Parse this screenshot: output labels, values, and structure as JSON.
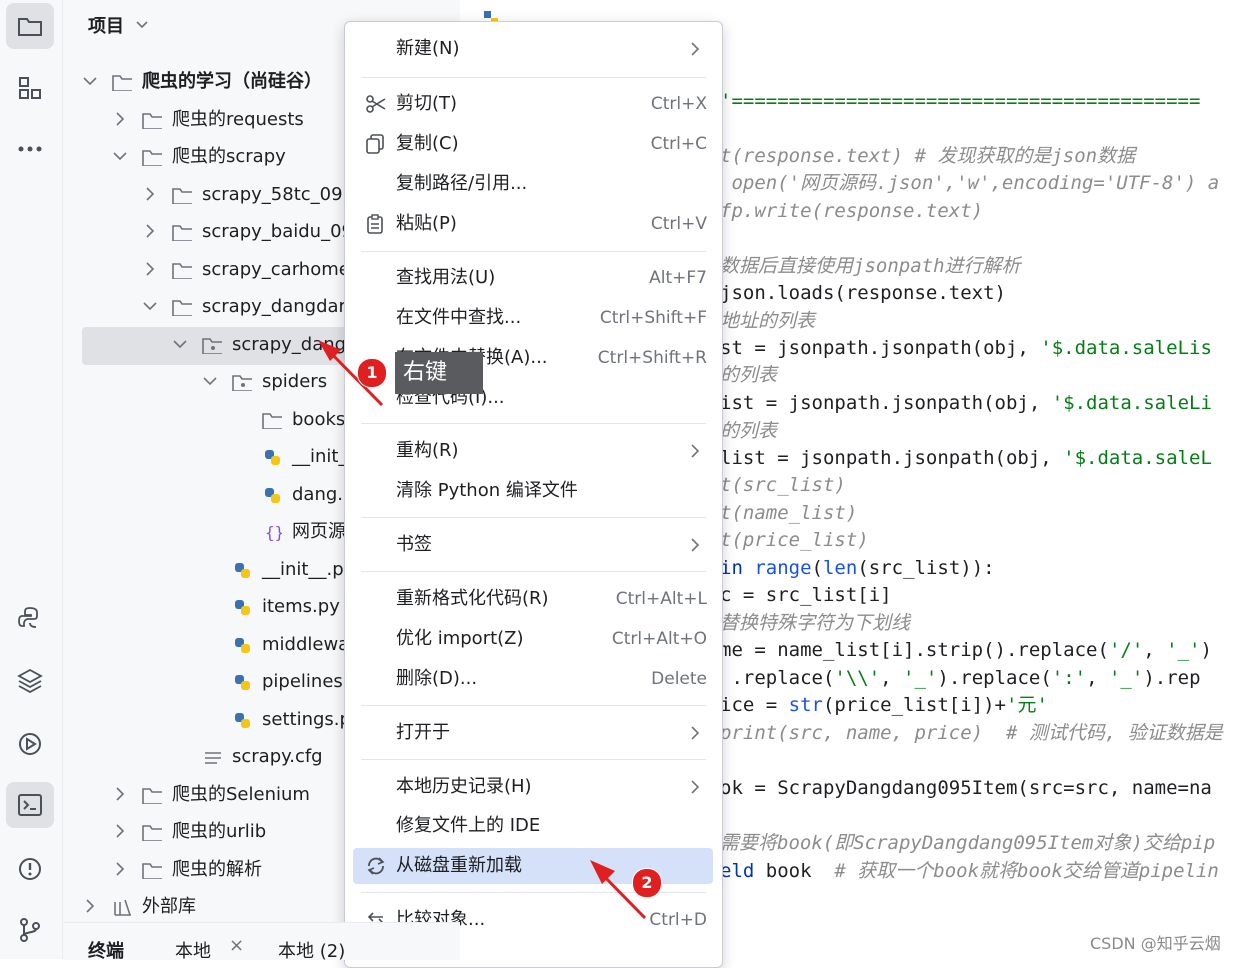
{
  "project_panel": {
    "title": "项目",
    "tree": [
      {
        "label": "爬虫的学习（尚硅谷）",
        "kind": "folder",
        "expanded": true
      },
      {
        "label": "爬虫的requests",
        "kind": "folder",
        "expanded": false
      },
      {
        "label": "爬虫的scrapy",
        "kind": "folder",
        "expanded": true
      },
      {
        "label": "scrapy_58tc_09",
        "kind": "folder",
        "expanded": false
      },
      {
        "label": "scrapy_baidu_09",
        "kind": "folder",
        "expanded": false
      },
      {
        "label": "scrapy_carhome",
        "kind": "folder",
        "expanded": false
      },
      {
        "label": "scrapy_dangdar",
        "kind": "folder",
        "expanded": true
      },
      {
        "label": "scrapy_dang",
        "kind": "package",
        "expanded": true
      },
      {
        "label": "spiders",
        "kind": "package",
        "expanded": true
      },
      {
        "label": "books",
        "kind": "folder"
      },
      {
        "label": "__init_",
        "kind": "python"
      },
      {
        "label": "dang.",
        "kind": "python"
      },
      {
        "label": "网页源",
        "kind": "json"
      },
      {
        "label": "__init__.py",
        "kind": "python"
      },
      {
        "label": "items.py",
        "kind": "python"
      },
      {
        "label": "middlewa",
        "kind": "python"
      },
      {
        "label": "pipelines.",
        "kind": "python"
      },
      {
        "label": "settings.p",
        "kind": "python"
      },
      {
        "label": "scrapy.cfg",
        "kind": "config"
      },
      {
        "label": "爬虫的Selenium",
        "kind": "folder",
        "expanded": false
      },
      {
        "label": "爬虫的urlib",
        "kind": "folder",
        "expanded": false
      },
      {
        "label": "爬虫的解析",
        "kind": "folder",
        "expanded": false
      },
      {
        "label": "外部库",
        "kind": "library",
        "expanded": false
      }
    ]
  },
  "bottom_tabs": {
    "terminal": "终端",
    "tab1": "本地",
    "tab2": "本地 (2)"
  },
  "context_menu": {
    "items": [
      {
        "label": "新建(N)",
        "submenu": true
      },
      {
        "label": "剪切(T)",
        "shortcut": "Ctrl+X",
        "icon": "scissors-icon"
      },
      {
        "label": "复制(C)",
        "shortcut": "Ctrl+C",
        "icon": "copy-icon"
      },
      {
        "label": "复制路径/引用..."
      },
      {
        "label": "粘贴(P)",
        "shortcut": "Ctrl+V",
        "icon": "paste-icon"
      },
      {
        "label": "查找用法(U)",
        "shortcut": "Alt+F7"
      },
      {
        "label": "在文件中查找...",
        "shortcut": "Ctrl+Shift+F"
      },
      {
        "label": "在文件中替换(A)...",
        "shortcut": "Ctrl+Shift+R"
      },
      {
        "label": "检查代码(I)..."
      },
      {
        "label": "重构(R)",
        "submenu": true
      },
      {
        "label": "清除 Python 编译文件"
      },
      {
        "label": "书签",
        "submenu": true
      },
      {
        "label": "重新格式化代码(R)",
        "shortcut": "Ctrl+Alt+L"
      },
      {
        "label": "优化 import(Z)",
        "shortcut": "Ctrl+Alt+O"
      },
      {
        "label": "删除(D)...",
        "shortcut": "Delete"
      },
      {
        "label": "打开于",
        "submenu": true
      },
      {
        "label": "本地历史记录(H)",
        "submenu": true
      },
      {
        "label": "修复文件上的 IDE"
      },
      {
        "label": "从磁盘重新加载",
        "icon": "reload-icon",
        "highlighted": true
      },
      {
        "label": "比较对象...",
        "shortcut": "Ctrl+D",
        "icon": "compare-icon"
      }
    ]
  },
  "annotations": {
    "badge1": "1",
    "right_click_label": "右键",
    "badge2": "2"
  },
  "code_lines": [
    {
      "parts": [
        [
          "str",
          "'========================================="
        ]
      ]
    },
    {
      "parts": [
        [
          "cm",
          "t(response.text) # 发现获取的是json数据"
        ]
      ]
    },
    {
      "parts": [
        [
          "cm",
          " open('网页源码.json','w',encoding='UTF-8') a"
        ]
      ]
    },
    {
      "parts": [
        [
          "cm",
          "fp.write(response.text)"
        ]
      ]
    },
    {
      "parts": [
        [
          "cm",
          "数据后直接使用jsonpath进行解析"
        ]
      ]
    },
    {
      "parts": [
        [
          "",
          "json.loads(response.text)"
        ]
      ]
    },
    {
      "parts": [
        [
          "cm",
          "地址的列表"
        ]
      ]
    },
    {
      "parts": [
        [
          "",
          "st = jsonpath.jsonpath(obj, "
        ],
        [
          "str",
          "'$.data.saleLis"
        ]
      ]
    },
    {
      "parts": [
        [
          "cm",
          "的列表"
        ]
      ]
    },
    {
      "parts": [
        [
          "",
          "ist = jsonpath.jsonpath(obj, "
        ],
        [
          "str",
          "'$.data.saleLi"
        ]
      ]
    },
    {
      "parts": [
        [
          "cm",
          "的列表"
        ]
      ]
    },
    {
      "parts": [
        [
          "",
          "list = jsonpath.jsonpath(obj, "
        ],
        [
          "str",
          "'$.data.saleL"
        ]
      ]
    },
    {
      "parts": [
        [
          "cm",
          "t(src_list)"
        ]
      ]
    },
    {
      "parts": [
        [
          "cm",
          "t(name_list)"
        ]
      ]
    },
    {
      "parts": [
        [
          "cm",
          "t(price_list)"
        ]
      ]
    },
    {
      "parts": [
        [
          "kw",
          "in "
        ],
        [
          "fn",
          "range"
        ],
        [
          "",
          "("
        ],
        [
          "fn",
          "len"
        ],
        [
          "",
          "(src_list)):"
        ]
      ]
    },
    {
      "parts": [
        [
          "",
          "c = src_list[i]"
        ]
      ]
    },
    {
      "parts": [
        [
          "cm",
          "替换特殊字符为下划线"
        ]
      ]
    },
    {
      "parts": [
        [
          "",
          "me = name_list[i].strip().replace("
        ],
        [
          "str",
          "'/'"
        ],
        [
          "",
          ", "
        ],
        [
          "str",
          "'_'"
        ],
        [
          "",
          ")"
        ]
      ]
    },
    {
      "parts": [
        [
          "",
          " .replace("
        ],
        [
          "str",
          "'\\\\'"
        ],
        [
          "",
          ", "
        ],
        [
          "str",
          "'_'"
        ],
        [
          "",
          ").replace("
        ],
        [
          "str",
          "':'"
        ],
        [
          "",
          ", "
        ],
        [
          "str",
          "'_'"
        ],
        [
          "",
          ").rep"
        ]
      ]
    },
    {
      "parts": [
        [
          "",
          "ice = "
        ],
        [
          "fn",
          "str"
        ],
        [
          "",
          "(price_list[i])+"
        ],
        [
          "str",
          "'元'"
        ]
      ]
    },
    {
      "parts": [
        [
          "cm",
          "print(src, name, price)  # 测试代码, 验证数据是"
        ]
      ]
    },
    {
      "parts": [
        [
          "",
          "ok = ScrapyDangdang095Item(src=src, name=na"
        ]
      ]
    },
    {
      "parts": [
        [
          "cm",
          "需要将book(即ScrapyDangdang095Item对象)交给pip"
        ]
      ]
    },
    {
      "parts": [
        [
          "kw",
          "eld "
        ],
        [
          "",
          "book  "
        ],
        [
          "cm",
          "# 获取一个book就将book交给管道pipelin"
        ]
      ]
    }
  ],
  "watermark": "CSDN @知乎云烟"
}
